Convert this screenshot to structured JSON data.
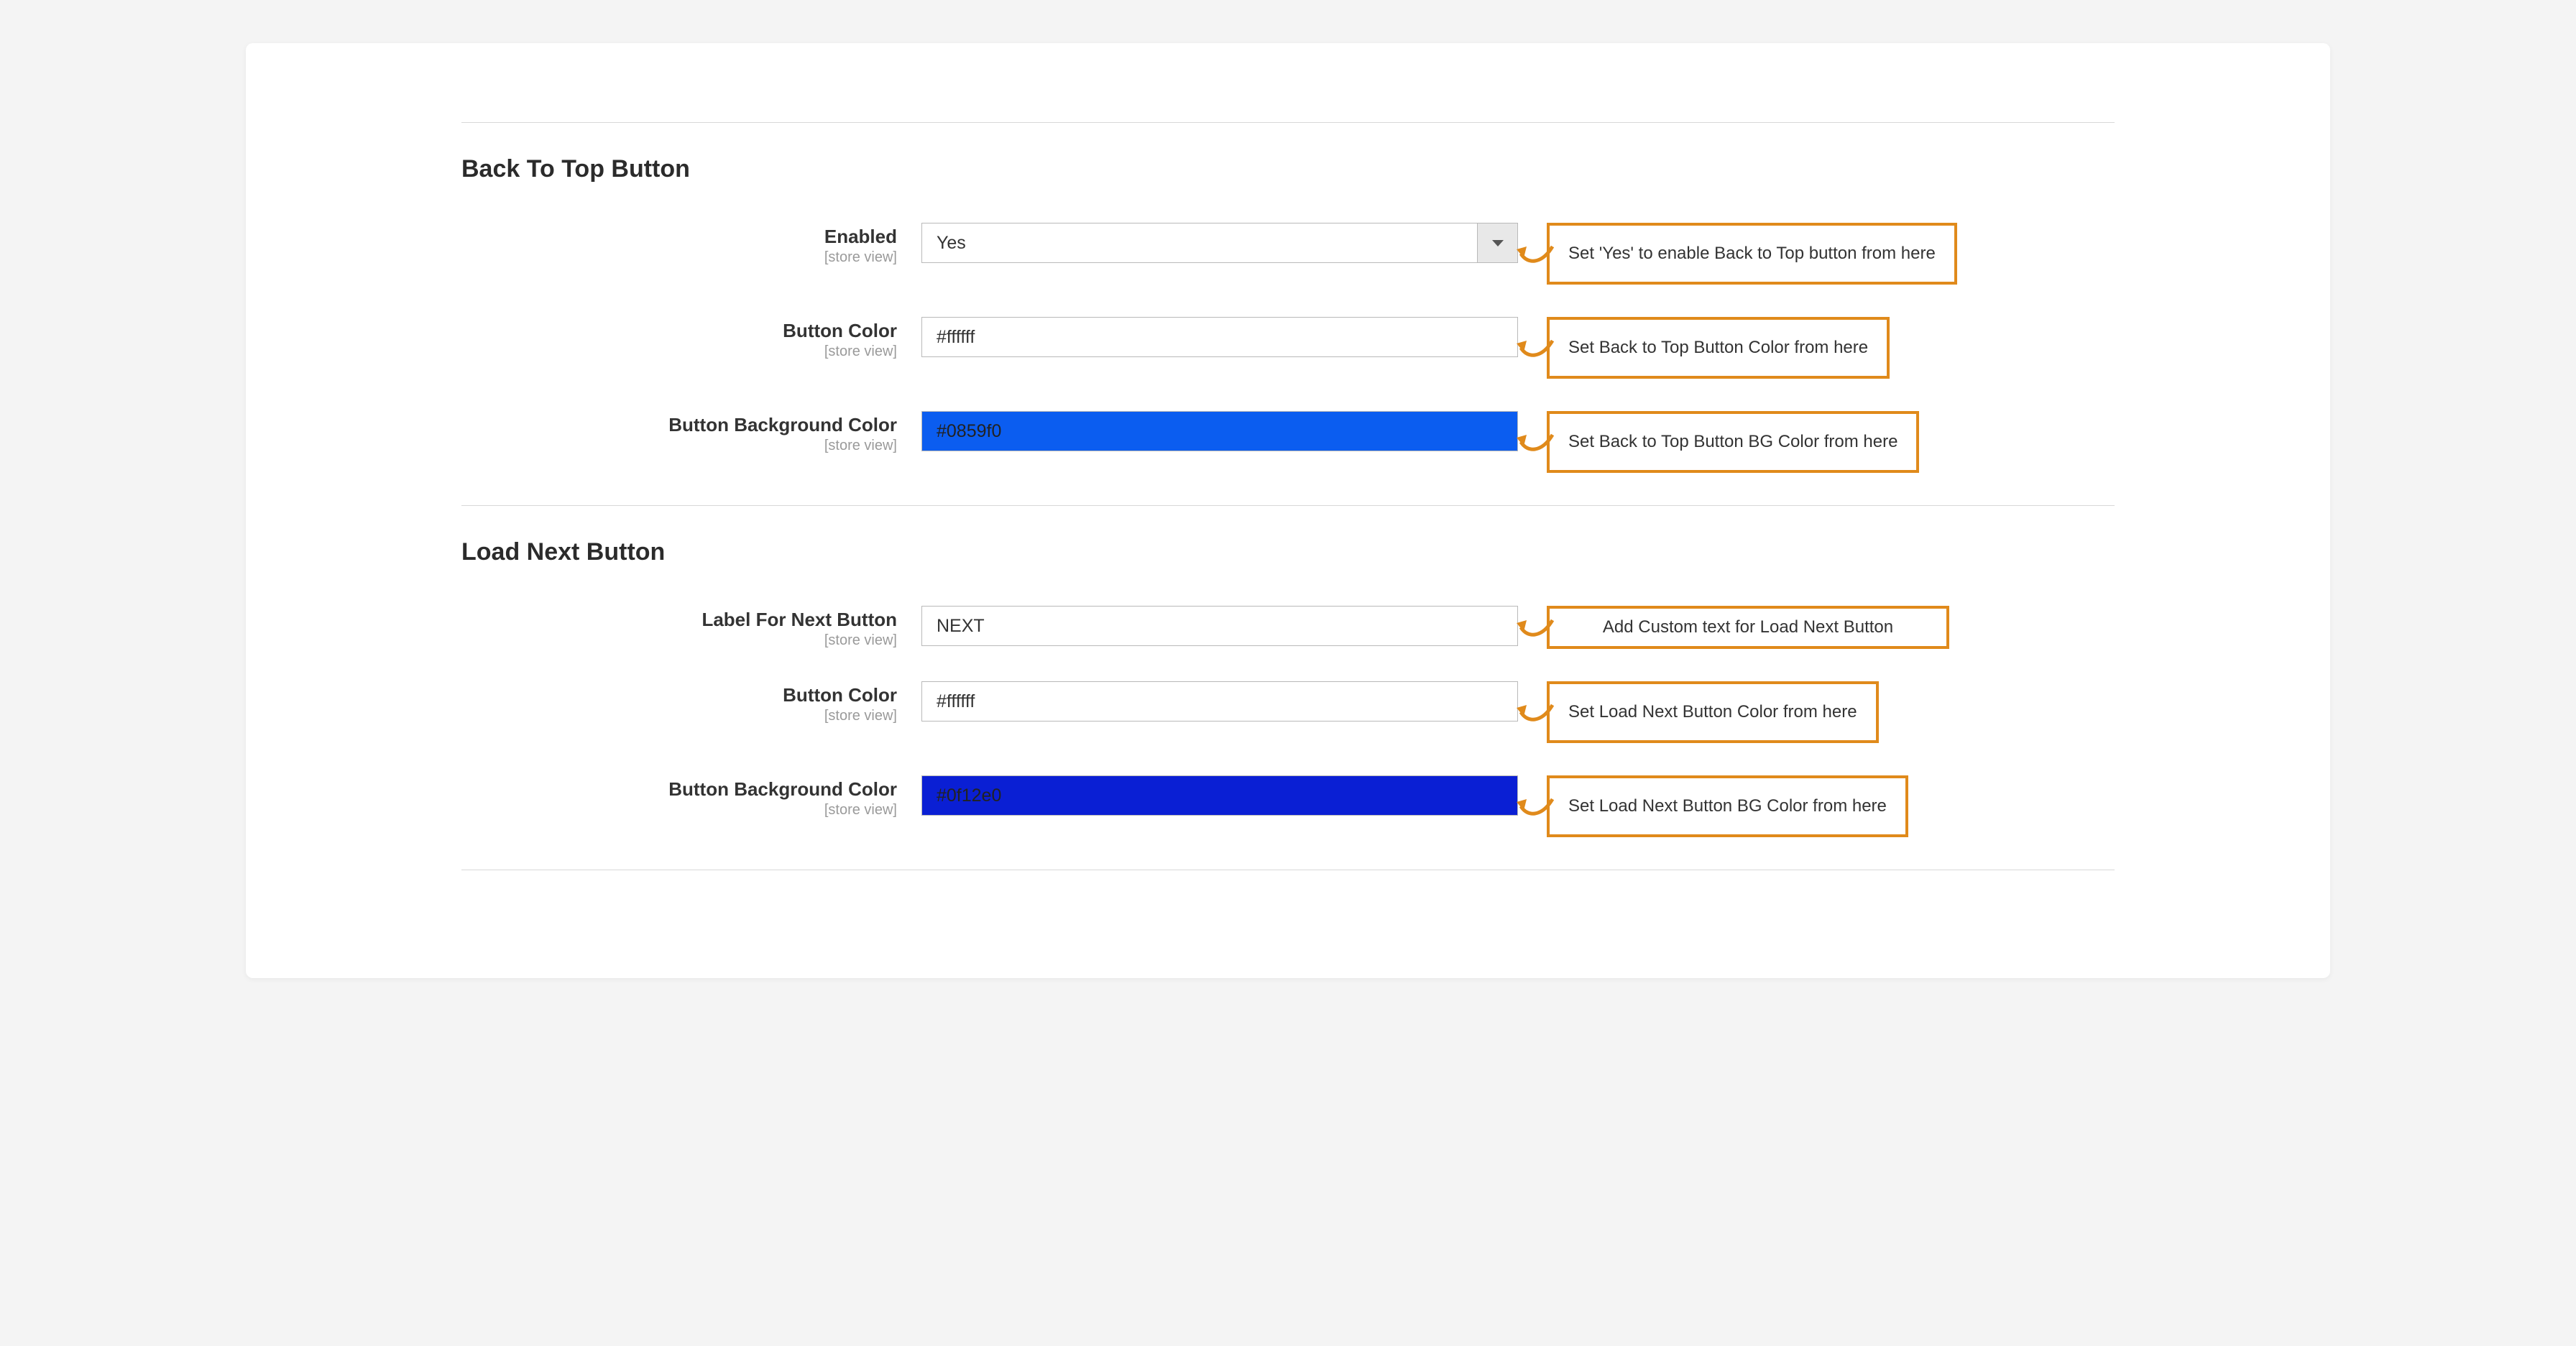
{
  "sections": {
    "back_to_top": {
      "title": "Back To Top Button",
      "fields": {
        "enabled": {
          "label": "Enabled",
          "scope": "[store view]",
          "value": "Yes",
          "annotation": "Set 'Yes' to enable Back to Top button from here"
        },
        "button_color": {
          "label": "Button Color",
          "scope": "[store view]",
          "value": "#ffffff",
          "annotation": "Set Back to Top Button Color from here"
        },
        "button_bg_color": {
          "label": "Button Background Color",
          "scope": "[store view]",
          "value": "#0859f0",
          "swatch": "#0b5df0",
          "annotation": "Set Back to Top Button BG Color from here"
        }
      }
    },
    "load_next": {
      "title": "Load Next Button",
      "fields": {
        "label_next": {
          "label": "Label For Next Button",
          "scope": "[store view]",
          "value": "NEXT",
          "annotation": "Add Custom text for Load Next Button"
        },
        "button_color": {
          "label": "Button Color",
          "scope": "[store view]",
          "value": "#ffffff",
          "annotation": "Set Load Next Button Color from here"
        },
        "button_bg_color": {
          "label": "Button Background Color",
          "scope": "[store view]",
          "value": "#0f12e0",
          "swatch": "#0a1fd4",
          "annotation": "Set Load Next Button BG Color from here"
        }
      }
    }
  }
}
